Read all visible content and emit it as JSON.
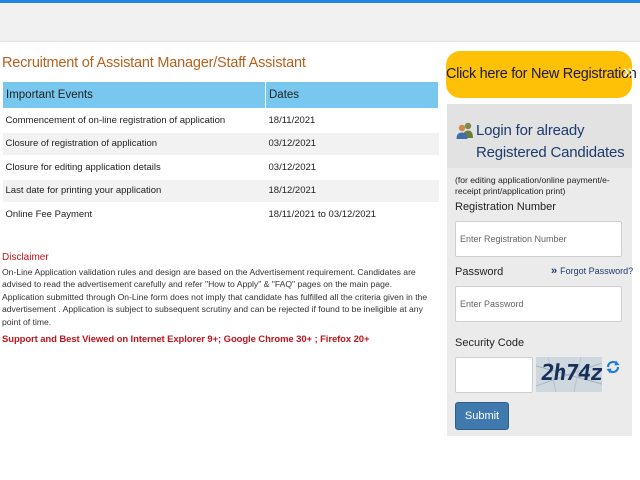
{
  "title": "Recruitment of Assistant Manager/Staff Assistant",
  "table": {
    "headers": [
      "Important Events",
      "Dates"
    ],
    "rows": [
      {
        "event": "Commencement of on-line registration of application",
        "date": "18/11/2021"
      },
      {
        "event": "Closure of registration of application",
        "date": "03/12/2021"
      },
      {
        "event": "Closure for editing application details",
        "date": "03/12/2021"
      },
      {
        "event": "Last date for printing your application",
        "date": "18/12/2021"
      },
      {
        "event": "Online Fee Payment",
        "date": "18/11/2021 to 03/12/2021"
      }
    ]
  },
  "disclaimer": {
    "title": "Disclaimer",
    "text": "On-Line Application validation rules and design are based on the Advertisement requirement. Candidates are advised to read the advertisement carefully and refer \"How to Apply\" & \"FAQ\" pages on the main page. Application submitted through On-Line form does not imply that candidate has fulfilled all the criteria given in the advertisement . Application is subject to subsequent scrutiny and can be rejected if found to be ineligible at any point of time."
  },
  "support": "Support and Best Viewed on Internet Explorer 9+; Google Chrome 30+ ; Firefox 20+",
  "registration": {
    "label": "Click here for New Registration",
    "chevron": "»"
  },
  "login": {
    "title_line1": "Login for already",
    "title_line2": "Registered Candidates",
    "note": "(for editing application/online payment/e-receipt print/application print)",
    "reg_label": "Registration Number",
    "reg_placeholder": "Enter Registration Number",
    "password_label": "Password",
    "forgot_arrow": "»",
    "forgot_label": "Forgot Password?",
    "password_placeholder": "Enter Password",
    "security_label": "Security Code",
    "captcha": "2h74z",
    "submit_label": "Submit"
  },
  "colors": {
    "accent": "#1e88e5",
    "table_header": "#77c7ef",
    "register_button": "#ffc107",
    "title_text": "#b8611e",
    "alert_text": "#c0161b",
    "submit_button": "#3f79ae"
  },
  "icons": [
    "users-icon",
    "refresh-icon",
    "double-chevron-right-icon"
  ]
}
